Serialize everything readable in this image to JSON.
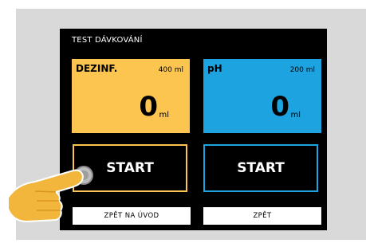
{
  "screen": {
    "title": "TEST DÁVKOVÁNÍ"
  },
  "tiles": [
    {
      "name": "DEZINF.",
      "capacity": "400 ml",
      "value": "0",
      "unit": "ml",
      "color": "#fcc54f"
    },
    {
      "name": "pH",
      "capacity": "200 ml",
      "value": "0",
      "unit": "ml",
      "color": "#1da3df"
    }
  ],
  "buttons": {
    "start_dez": "START",
    "start_ph": "START",
    "back_home": "ZPĚT NA ÚVOD",
    "back": "ZPĚT"
  },
  "icons": {
    "pointer": "tap-hand-icon"
  }
}
